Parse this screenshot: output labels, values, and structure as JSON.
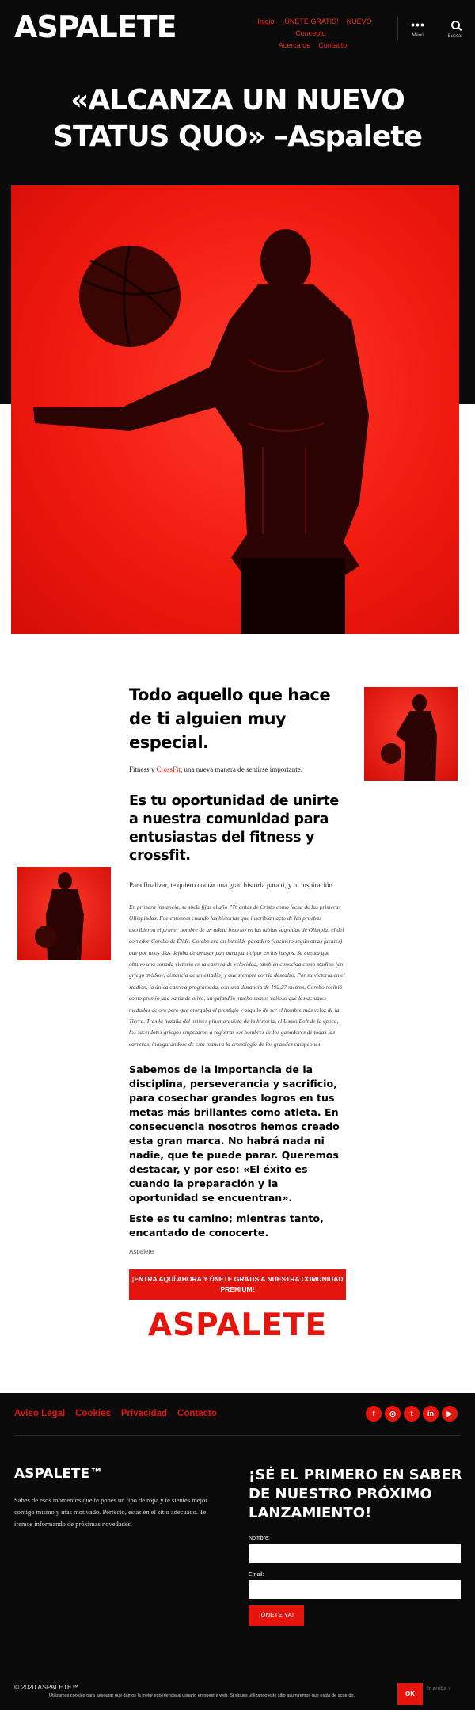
{
  "header": {
    "logo": "ASPALETE",
    "nav": {
      "inicio": "Inicio",
      "unete": "¡ÚNETE GRATIS!",
      "nuevo": "NUEVO Concepto",
      "acerca": "Acerca de",
      "contacto": "Contacto"
    },
    "menu_label": "Menú",
    "search_label": "Buscar"
  },
  "hero": {
    "title_line1": "«ALCANZA UN NUEVO",
    "title_line2": "STATUS QUO» –Aspalete"
  },
  "content": {
    "heading_special": "Todo aquello que hace de ti alguien muy especial.",
    "intro_prefix": "Fitness y ",
    "intro_link": "CrossFit",
    "intro_suffix": ", una nueva manera de sentirse importante.",
    "heading_oportunidad": "Es tu oportunidad de unirte a nuestra comunidad para entusiastas del fitness y crossfit.",
    "para1": "Para finalizar, te quiero contar una gran historia para ti, y tu inspiración.",
    "story": "En primera instancia, se suele fijar el año 776 antes de Cristo como fecha de las primeras Olimpiadas. Fue entonces cuando las historias que inscribían acto de las pruebas escribieron el primer nombre de un atleta inscrito en las tablas sagradas de Olimpia: el del corredor Corebo de Élide. Corebo era un humilde panadero (cocinero según otras fuentes) que por unos días dejaba de amasar pan para participar en los juegos. Se cuenta que obtuvo una sonada victoria en la carrera de velocidad, también conocida como stadion (en griego στάδιον, distancia de un estadio) y que siempre corría descalzo. Por su victoria en el stadion, la única carrera programada, con una distancia de 192,27 metros, Corebo recibió como premio una rama de olivo, un galardón mucho menos valioso que las actuales medallas de oro pero que otorgaba el prestigio y orgullo de ser el hombre más veloz de la Tierra. Tras la hazaña del primer plusmarquista de la historia, el Usain Bolt de la época, los sacerdotes griegos empezaron a registrar los nombres de los ganadores de todas las carreras, inaugurándose de esta manera la cronología de los grandes campeones.",
    "bold_para": "Sabemos de la importancia de la disciplina, perseverancia y sacrificio, para cosechar grandes logros en tus metas más brillantes como atleta. En consecuencia nosotros hemos creado esta gran marca. No habrá nada ni nadie, que te puede parar. Queremos destacar, y por eso: «El éxito es cuando la preparación y la oportunidad se encuentran».",
    "closing": "Este es tu camino; mientras tanto, encantado de conocerte.",
    "signature": "Aspalete",
    "cta": "¡ENTRA AQUÍ AHORA Y ÚNETE GRATIS A NUESTRA COMUNIDAD PREMIUM!",
    "big_logo": "ASPALETE"
  },
  "footer": {
    "links": {
      "aviso": "Aviso Legal",
      "cookies": "Cookies",
      "privacidad": "Privacidad",
      "contacto": "Contacto"
    },
    "social_icons": [
      "facebook-icon",
      "instagram-icon",
      "twitter-icon",
      "linkedin-icon",
      "youtube-icon"
    ],
    "brand": "ASPALETE™",
    "brand_text": "Sabes de esos momentos que te pones un tipo de ropa y te sientes mejor contigo mismo y más motivado. Perfecto, estás en el sitio adecuado. Te iremos informando de próximas novedades.",
    "newsletter_title": "¡SÉ EL PRIMERO EN SABER DE NUESTRO PRÓXIMO LANZAMIENTO!",
    "name_label": "Nombre:",
    "email_label": "Email:",
    "submit": "¡ÚNETE YA!",
    "copyright": "© 2020 ASPALETE™",
    "cookie_text": "Utilizamos cookies para asegurar que damos la mejor experiencia al usuario en nuestra web. Si sigues utilizando este sitio asumiremos que estás de acuerdo.",
    "ok": "OK",
    "top_link": "Ir arriba ↑"
  },
  "colors": {
    "accent": "#e5140c",
    "dark": "#0a0a0a"
  }
}
